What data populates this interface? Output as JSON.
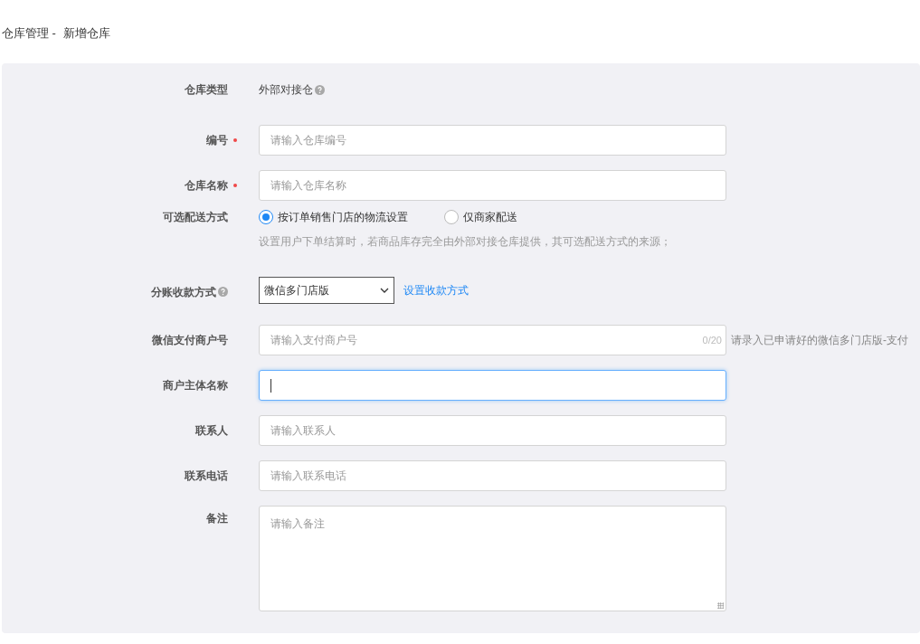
{
  "breadcrumb": {
    "parent": "仓库管理 -",
    "current": "新增仓库"
  },
  "form": [
    {
      "kind": "static",
      "label": "仓库类型",
      "required": false,
      "help": false,
      "value": "外部对接仓",
      "value_help": true
    },
    {
      "kind": "input",
      "label": "编号",
      "required": true,
      "help": false,
      "placeholder": "请输入仓库编号",
      "focused": false
    },
    {
      "kind": "input",
      "label": "仓库名称",
      "required": true,
      "help": false,
      "placeholder": "请输入仓库名称",
      "focused": false
    },
    {
      "kind": "radio",
      "label": "可选配送方式",
      "required": false,
      "help": false,
      "options": [
        {
          "label": "按订单销售门店的物流设置",
          "selected": true
        },
        {
          "label": "仅商家配送",
          "selected": false
        }
      ],
      "hint": "设置用户下单结算时，若商品库存完全由外部对接仓库提供，其可选配送方式的来源；"
    },
    {
      "kind": "select",
      "label": "分账收款方式",
      "required": false,
      "help": true,
      "value": "微信多门店版",
      "link": "设置收款方式"
    },
    {
      "kind": "input",
      "label": "微信支付商户号",
      "required": false,
      "help": false,
      "placeholder": "请输入支付商户号",
      "focused": false,
      "counter": "0/20",
      "side_hint": "请录入已申请好的微信多门店版-支付"
    },
    {
      "kind": "input",
      "label": "商户主体名称",
      "required": false,
      "help": false,
      "focused": true
    },
    {
      "kind": "input",
      "label": "联系人",
      "required": false,
      "help": false,
      "placeholder": "请输入联系人",
      "focused": false
    },
    {
      "kind": "input",
      "label": "联系电话",
      "required": false,
      "help": false,
      "placeholder": "请输入联系电话",
      "focused": false
    },
    {
      "kind": "textarea",
      "label": "备注",
      "required": false,
      "help": false,
      "placeholder": "请输入备注"
    }
  ]
}
